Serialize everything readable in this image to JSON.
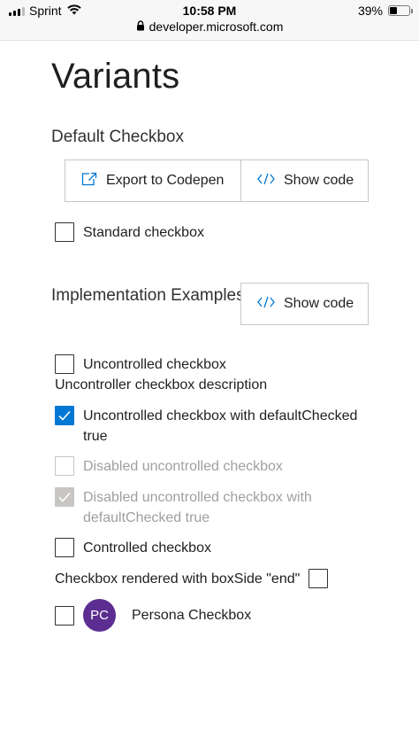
{
  "status_bar": {
    "carrier": "Sprint",
    "time": "10:58 PM",
    "battery_percent": "39%",
    "battery_level": 0.39,
    "url": "developer.microsoft.com"
  },
  "page": {
    "title": "Variants"
  },
  "default_section": {
    "title": "Default Checkbox",
    "export_button": "Export to Codepen",
    "show_code_button": "Show code",
    "standard_checkbox": "Standard checkbox"
  },
  "implementation_section": {
    "title": "Implementation Examples",
    "show_code_button": "Show code",
    "uncontrolled": "Uncontrolled checkbox",
    "uncontrolled_description": "Uncontroller checkbox description",
    "uncontrolled_default_checked_line1": "Uncontrolled checkbox with defaultChecked",
    "uncontrolled_default_checked_line2": "true",
    "disabled_uncontrolled": "Disabled uncontrolled checkbox",
    "disabled_default_checked_line1": "Disabled uncontrolled checkbox with",
    "disabled_default_checked_line2": "defaultChecked true",
    "controlled": "Controlled checkbox",
    "box_side_end": "Checkbox rendered with boxSide \"end\"",
    "persona_initials": "PC",
    "persona_label": "Persona Checkbox"
  },
  "colors": {
    "accent": "#0078d4",
    "persona": "#5c2e91",
    "disabled": "#c8c6c4"
  },
  "icons": {
    "export": "export-icon",
    "code": "code-icon",
    "check": "checkmark-icon",
    "lock": "lock-icon",
    "wifi": "wifi-icon",
    "signal": "signal-icon",
    "battery": "battery-icon"
  }
}
